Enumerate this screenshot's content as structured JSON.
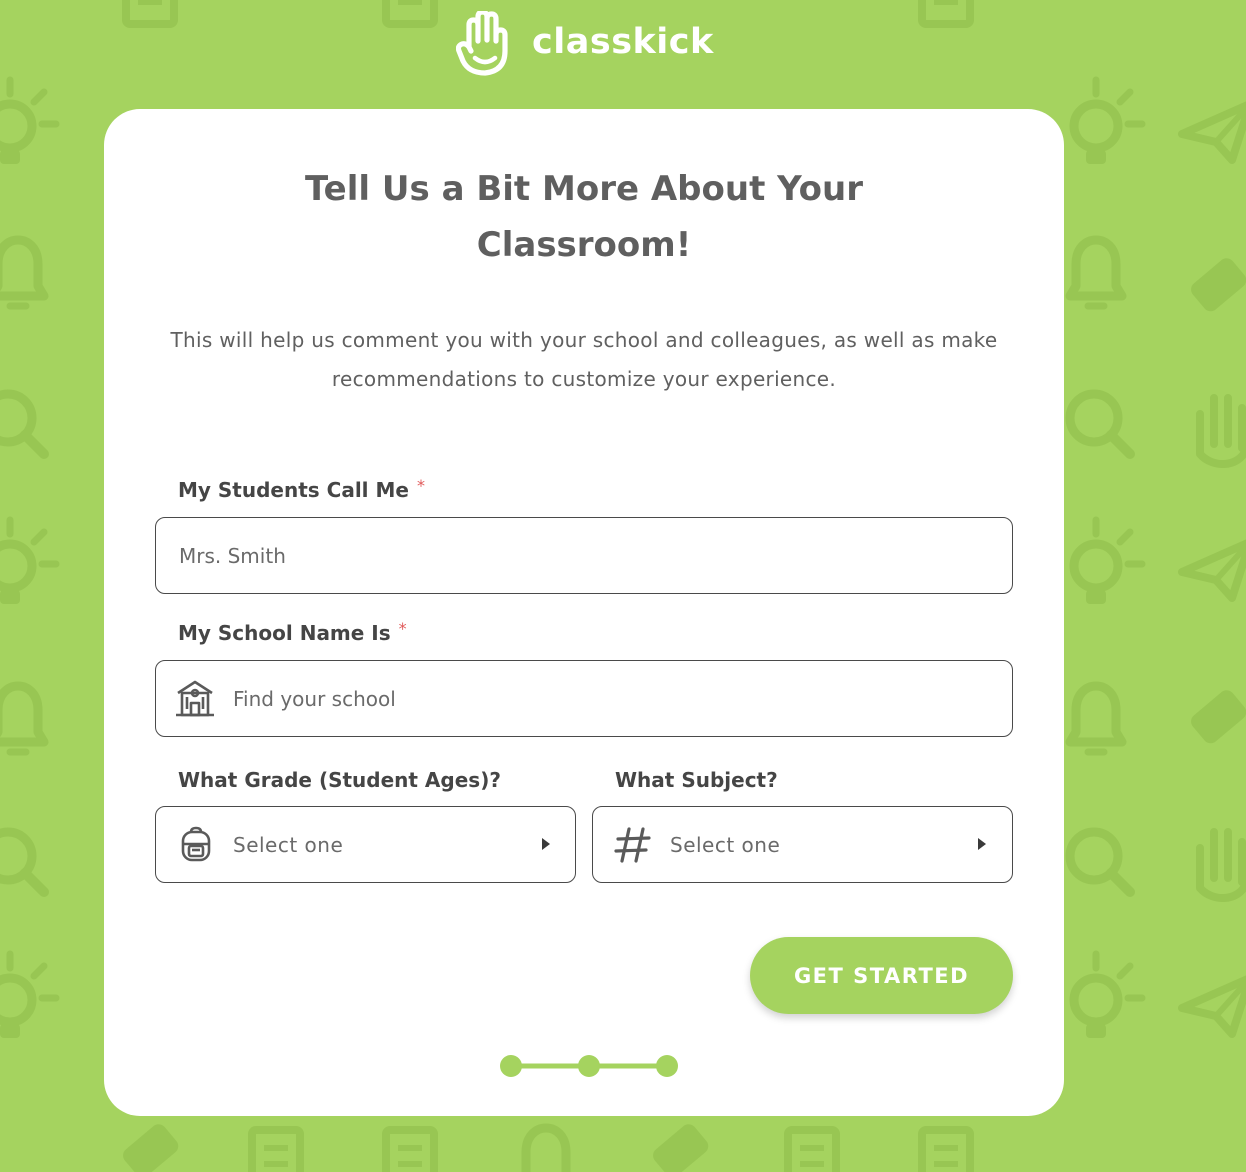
{
  "brand": {
    "name": "classkick",
    "color": "#a5d35f"
  },
  "card": {
    "title": "Tell Us a Bit More About Your Classroom!",
    "subtitle": "This will help us comment you with your school and colleagues, as well as make recommendations to customize your experience."
  },
  "form": {
    "students_call_me": {
      "label": "My Students Call Me",
      "required_mark": "*",
      "placeholder": "Mrs. Smith",
      "value": ""
    },
    "school_name": {
      "label": "My School Name Is",
      "required_mark": "*",
      "placeholder": "Find your school",
      "value": "",
      "icon": "school-building-icon"
    },
    "grade": {
      "label": "What Grade (Student Ages)?",
      "selected": "Select one",
      "icon": "backpack-icon"
    },
    "subject": {
      "label": "What Subject?",
      "selected": "Select one",
      "icon": "hashtag-icon"
    },
    "submit_label": "GET STARTED"
  },
  "progress": {
    "total_steps": 3,
    "current_step": 3
  }
}
